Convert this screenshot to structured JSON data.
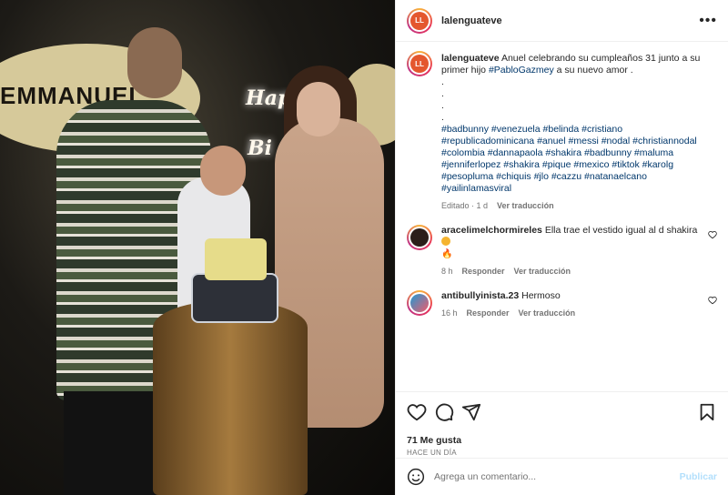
{
  "photo": {
    "banner_text": "EMMANUEL",
    "neon_top": "Hap",
    "neon_bottom": "Bi"
  },
  "header": {
    "username": "lalenguateve",
    "more_icon": "more-horizontal-icon"
  },
  "caption": {
    "username": "lalenguateve",
    "text_before": "Anuel celebrando su cumpleaños 31 junto a su primer hijo ",
    "mention": "#PabloGazmey",
    "text_after": " a su nuevo amor .",
    "dots": [
      ".",
      ".",
      ".",
      "."
    ],
    "hashtags": "#badbunny #venezuela #belinda #cristiano #republicadominicana #anuel #messi #nodal #christiannodal #colombia #dannapaola #shakira #badbunny #maluma #jenniferlopez #shakira #pique #mexico #tiktok #karolg #pesopluma #chiquis #jlo #cazzu #natanaelcano #yailinlamasviral",
    "edited": "Editado · 1 d",
    "see_translation": "Ver traducción"
  },
  "comments": [
    {
      "username": "aracelimelchormireles",
      "text": "Ella trae el vestido igual al d shakira",
      "time": "8 h",
      "reply": "Responder",
      "translation": "Ver traducción"
    },
    {
      "username": "antibullyinista.23",
      "text": "Hermoso",
      "time": "16 h",
      "reply": "Responder",
      "translation": "Ver traducción"
    }
  ],
  "actions": {
    "likes": "71 Me gusta",
    "posted": "HACE UN DÍA"
  },
  "compose": {
    "placeholder": "Agrega un comentario...",
    "publish": "Publicar"
  },
  "colors": {
    "link": "#00376b",
    "publish_disabled": "#b2dffc",
    "muted": "#737373"
  }
}
